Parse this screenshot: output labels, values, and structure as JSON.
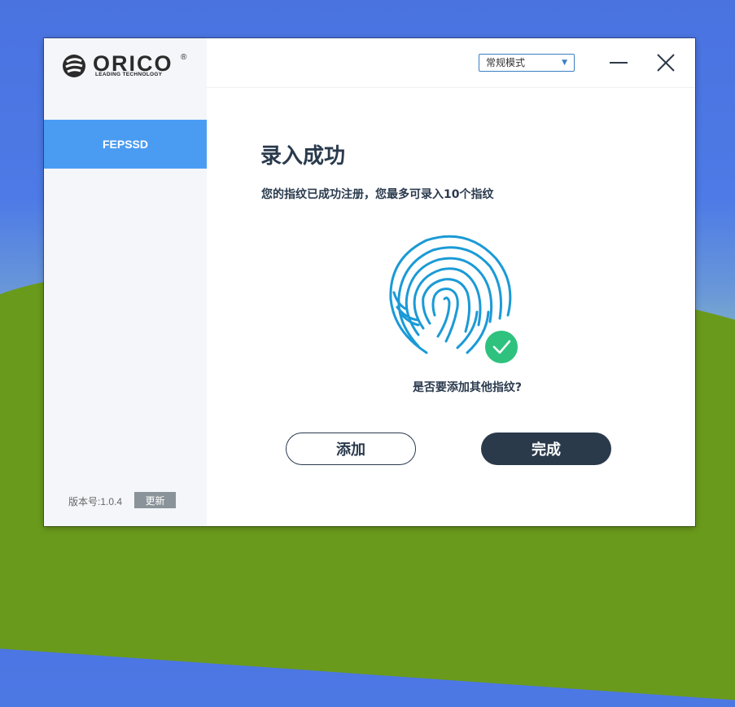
{
  "brand": {
    "name": "ORICO",
    "tagline": "LEADING TECHNOLOGY",
    "registered": "®"
  },
  "sidebar": {
    "items": [
      {
        "label": "FEPSSD",
        "active": true
      }
    ],
    "version_label": "版本号:1.0.4",
    "update_label": "更新"
  },
  "header": {
    "mode_select": {
      "value": "常规模式",
      "arrow": "▼"
    }
  },
  "main": {
    "title": "录入成功",
    "subtitle": "您的指纹已成功注册，您最多可录入10个指纹",
    "question": "是否要添加其他指纹?",
    "add_label": "添加",
    "done_label": "完成"
  },
  "icons": {
    "fingerprint": "fingerprint-icon",
    "check": "check-icon",
    "minimize": "minimize-icon",
    "close": "close-icon"
  },
  "colors": {
    "accent_blue": "#4a9cf2",
    "fingerprint_blue": "#1a9ad6",
    "success_green": "#2ec27e",
    "dark_navy": "#2b3a4b"
  }
}
